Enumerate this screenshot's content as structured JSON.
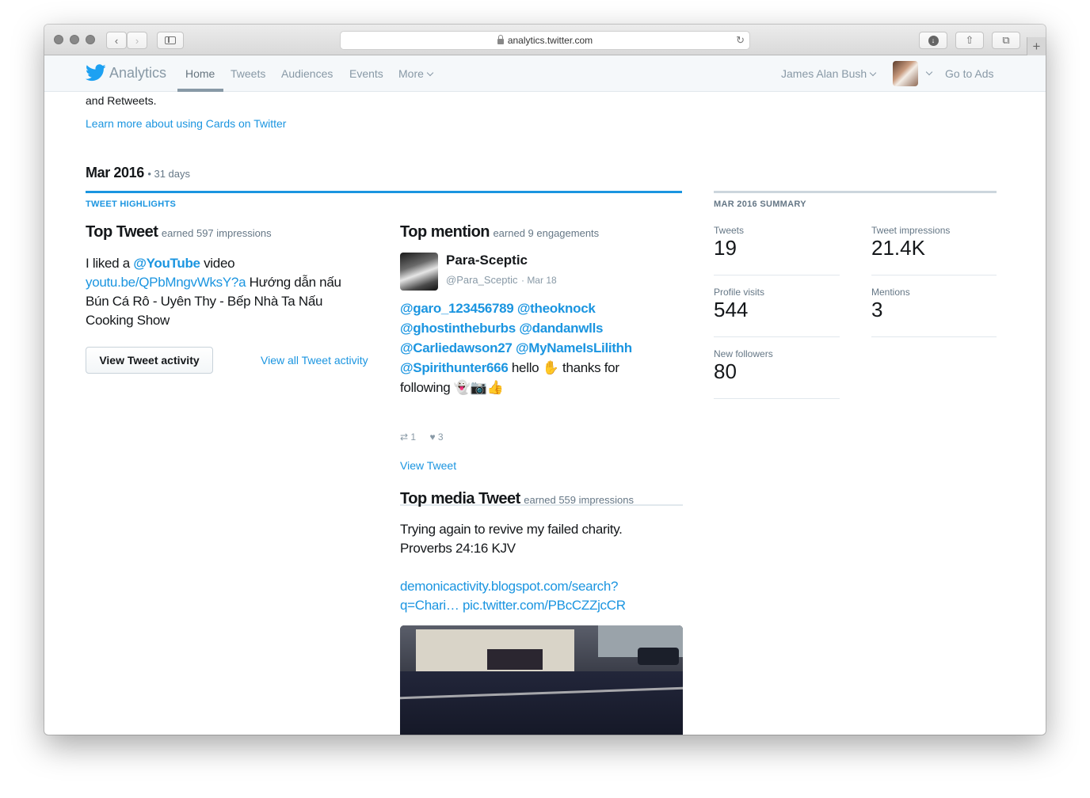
{
  "browser": {
    "url": "analytics.twitter.com"
  },
  "nav": {
    "brand": "Analytics",
    "links": [
      "Home",
      "Tweets",
      "Audiences",
      "Events",
      "More"
    ],
    "user": "James Alan Bush",
    "go_to_ads": "Go to Ads"
  },
  "intro": {
    "fragment": "and Retweets.",
    "learn_more": "Learn more about using Cards on Twitter"
  },
  "period": {
    "month": "Mar 2016",
    "days": "• 31 days"
  },
  "highlights": {
    "heading": "TWEET HIGHLIGHTS",
    "top_tweet": {
      "title": "Top Tweet",
      "sub": "earned 597 impressions",
      "text_prefix": "I liked a ",
      "mention": "@YouTube",
      "text_mid": " video",
      "link": "youtu.be/QPbMngvWksY?a",
      "text_rest": " Hướng dẫn nấu Bún Cá Rô - Uyên Thy - Bếp Nhà Ta Nấu Cooking Show",
      "button": "View Tweet activity",
      "view_all": "View all Tweet activity"
    },
    "top_mention": {
      "title": "Top mention",
      "sub": "earned 9 engagements",
      "name": "Para-Sceptic",
      "handle": "@Para_Sceptic",
      "date": "· Mar 18",
      "mentions": [
        "@garo_123456789",
        "@theoknock",
        "@ghostintheburbs",
        "@dandanwlls",
        "@Carliedawson27",
        "@MyNameIsLilithh",
        "@Spirithunter666"
      ],
      "text_hello": " hello ✋ thanks for following 👻📷👍",
      "retweets": "1",
      "likes": "3",
      "view_tweet": "View Tweet"
    },
    "top_media": {
      "title": "Top media Tweet",
      "sub": "earned 559 impressions",
      "text_line1": "Trying again to revive my failed charity.",
      "text_line2": "Proverbs 24:16 KJV",
      "link_line1": "demonicactivity.blogspot.com/search?",
      "link_line2": "q=Chari… pic.twitter.com/PBcCZZjcCR"
    }
  },
  "summary": {
    "heading": "MAR 2016 SUMMARY",
    "stats": [
      {
        "label": "Tweets",
        "value": "19"
      },
      {
        "label": "Tweet impressions",
        "value": "21.4K"
      },
      {
        "label": "Profile visits",
        "value": "544"
      },
      {
        "label": "Mentions",
        "value": "3"
      },
      {
        "label": "New followers",
        "value": "80"
      }
    ]
  },
  "colors": {
    "accent": "#1b95e0",
    "summary_rule": "#ccd6dd",
    "text": "#14171a",
    "muted": "#657786"
  }
}
